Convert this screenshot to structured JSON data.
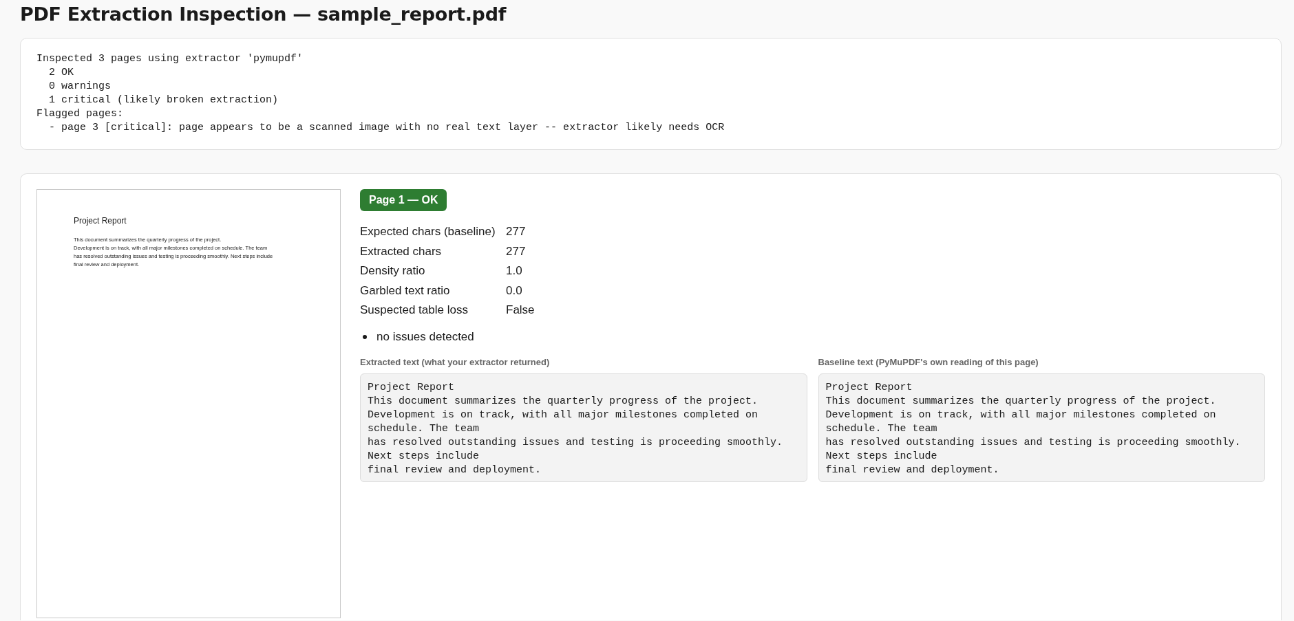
{
  "title": "PDF Extraction Inspection — sample_report.pdf",
  "summary": {
    "lines": [
      "Inspected 3 pages using extractor 'pymupdf'",
      "  2 OK",
      "  0 warnings",
      "  1 critical (likely broken extraction)",
      "Flagged pages:",
      "  - page 3 [critical]: page appears to be a scanned image with no real text layer -- extractor likely needs OCR"
    ]
  },
  "pages": [
    {
      "badge": "Page 1 — OK",
      "kind": "ok",
      "thumbnail": {
        "heading": "Project Report",
        "lines": [
          "This document summarizes the quarterly progress of the project.",
          "Development is on track, with all major milestones completed on schedule. The team",
          "has resolved outstanding issues and testing is proceeding smoothly. Next steps include",
          "final review and deployment."
        ]
      },
      "metrics": [
        {
          "label": "Expected chars (baseline)",
          "value": "277"
        },
        {
          "label": "Extracted chars",
          "value": "277"
        },
        {
          "label": "Density ratio",
          "value": "1.0"
        },
        {
          "label": "Garbled text ratio",
          "value": "0.0"
        },
        {
          "label": "Suspected table loss",
          "value": "False"
        }
      ],
      "issues": [
        "no issues detected"
      ],
      "texts": [
        {
          "label": "Extracted text (what your extractor returned)",
          "content": "Project Report\nThis document summarizes the quarterly progress of the project.\nDevelopment is on track, with all major milestones completed on schedule. The team\nhas resolved outstanding issues and testing is proceeding smoothly. Next steps include\nfinal review and deployment."
        },
        {
          "label": "Baseline text (PyMuPDF's own reading of this page)",
          "content": "Project Report\nThis document summarizes the quarterly progress of the project.\nDevelopment is on track, with all major milestones completed on schedule. The team\nhas resolved outstanding issues and testing is proceeding smoothly. Next steps include\nfinal review and deployment."
        }
      ]
    }
  ]
}
